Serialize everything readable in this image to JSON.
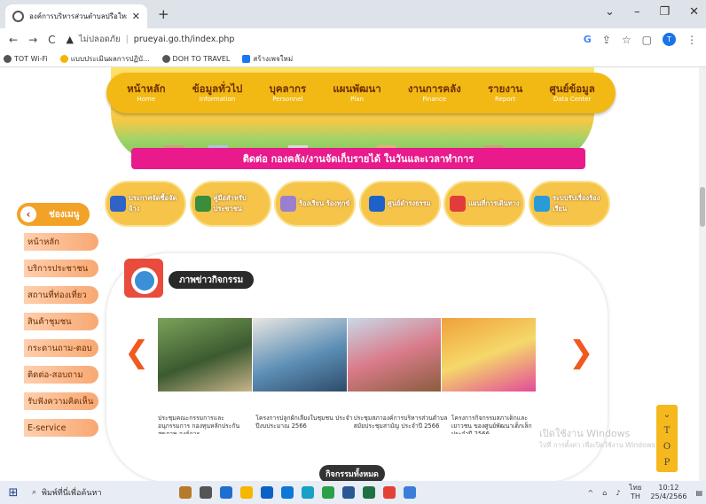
{
  "browser": {
    "tab_title": "องค์การบริหารส่วนตำบลปรือใหญ่ อำเภ",
    "security_label": "ไม่ปลอดภัย",
    "url": "prueyai.go.th/index.php",
    "bookmarks": [
      "TOT Wi-Fi",
      "แบบประเมินผลการปฏิบั...",
      "DOH TO TRAVEL",
      "สร้างเพจใหม่"
    ],
    "profile_initial": "T"
  },
  "nav": [
    {
      "th": "หน้าหลัก",
      "en": "Home"
    },
    {
      "th": "ข้อมูลทั่วไป",
      "en": "Information"
    },
    {
      "th": "บุคลากร",
      "en": "Personnel"
    },
    {
      "th": "แผนพัฒนา",
      "en": "Plan"
    },
    {
      "th": "งานการคลัง",
      "en": "Finance"
    },
    {
      "th": "รายงาน",
      "en": "Report"
    },
    {
      "th": "ศูนย์ข้อมูล",
      "en": "Data Center"
    }
  ],
  "contact_banner": "ติดต่อ กองคลัง/งานจัดเก็บรายได้ ในวันและเวลาทำการ",
  "side_menu": {
    "header": "ช่องเมนู",
    "items": [
      "หน้าหลัก",
      "บริการประชาชน",
      "สถานที่ท่องเที่ยว",
      "สินค้าชุมชน",
      "กระดานถาม-ตอบ",
      "ติดต่อ-สอบถาม",
      "รับฟังความคิดเห็น",
      "E-service"
    ]
  },
  "services": [
    "ประกาศจัดซื้อจัดจ้าง",
    "คู่มือสำหรับประชาชน",
    "ร้องเรียน ร้องทุกข์",
    "ศูนย์ดำรงธรรม",
    "แผนที่การเดินทาง",
    "ระบบรับเรื่องร้องเรียน"
  ],
  "news": {
    "title": "ภาพข่าวกิจกรรม",
    "captions": [
      "ประชุมคณะกรรมการและอนุกรรมการ กองทุนหลักประกันสุขภาพ องค์การ",
      "โครงการปลูกผักเลี้ยงในชุมชน ประจำปีงบประมาณ 2566",
      "ประชุมสภาองค์การบริหารส่วนตำบล สมัยประชุมสามัญ ประจำปี 2566",
      "โครงการกิจกรรมสภาเด็กและเยาวชน ของศูนย์พัฒนาเด็กเล็ก ประจำปี 2566"
    ],
    "all_button": "กิจกรรมทั้งหมด"
  },
  "activation": {
    "line1": "เปิดใช้งาน Windows",
    "line2": "ไปที่ การตั้งค่า เพื่อเปิดใช้งาน Windows"
  },
  "top_button": [
    "T",
    "O",
    "P"
  ],
  "taskbar": {
    "search_placeholder": "พิมพ์ที่นี่เพื่อค้นหา",
    "language": "ไทย",
    "lang_code": "TH",
    "time": "10:12",
    "date": "25/4/2566"
  },
  "colors": {
    "nav_bg": "#f2b914",
    "contact_bg": "#e81a8c",
    "side_item": "#f8a872",
    "arrow": "#f05a1e"
  }
}
